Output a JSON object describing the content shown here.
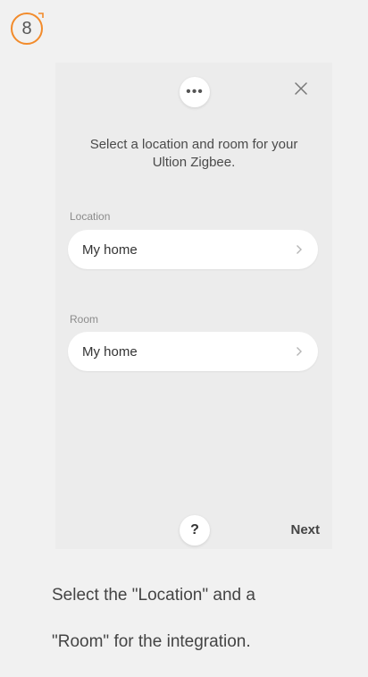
{
  "step": {
    "number": "8",
    "accent_color": "#f28b2b"
  },
  "panel": {
    "more_icon": "more-dots-icon",
    "close_icon": "close-icon",
    "title_line1": "Select a location and room for your",
    "title_line2": "Ultion Zigbee.",
    "location": {
      "label": "Location",
      "value": "My home",
      "chevron": "chevron-right-icon"
    },
    "room": {
      "label": "Room",
      "value": "My home",
      "chevron": "chevron-right-icon"
    },
    "help_label": "?",
    "next_label": "Next"
  },
  "caption": {
    "line1": "Select the \"Location\" and a",
    "line2": "\"Room\" for the integration."
  }
}
